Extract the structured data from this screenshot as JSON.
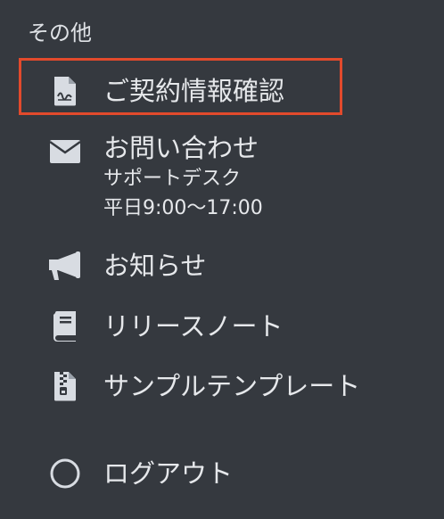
{
  "section": {
    "title": "その他"
  },
  "items": [
    {
      "label": "ご契約情報確認",
      "icon": "contract-document-icon",
      "highlighted": true
    },
    {
      "label": "お問い合わせ",
      "icon": "envelope-icon",
      "sub1": "サポートデスク",
      "sub2": "平日9:00〜17:00"
    },
    {
      "label": "お知らせ",
      "icon": "megaphone-icon"
    },
    {
      "label": "リリースノート",
      "icon": "book-icon"
    },
    {
      "label": "サンプルテンプレート",
      "icon": "zip-file-icon"
    },
    {
      "label": "ログアウト",
      "icon": "circle-icon"
    }
  ],
  "colors": {
    "background": "#35393f",
    "text": "#e6e8eb",
    "icon": "#d8dce2",
    "highlight_border": "#e24a2c"
  }
}
